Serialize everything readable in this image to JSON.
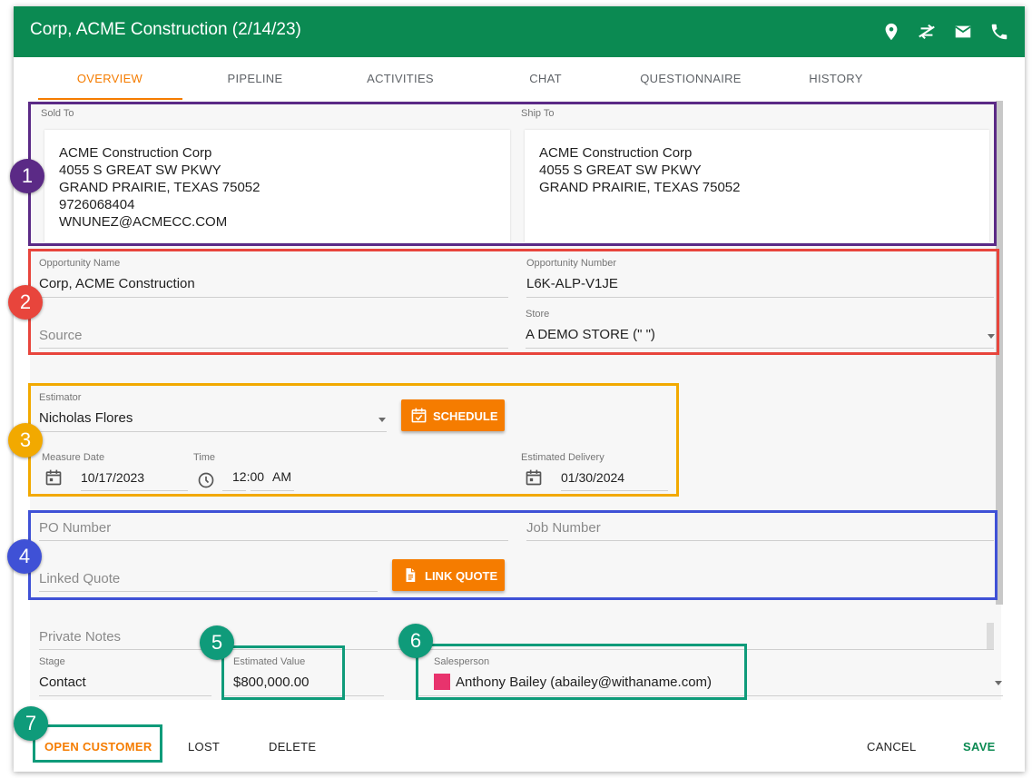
{
  "header": {
    "title": "Corp, ACME Construction (2/14/23)"
  },
  "tabs": [
    {
      "label": "OVERVIEW"
    },
    {
      "label": "PIPELINE"
    },
    {
      "label": "ACTIVITIES"
    },
    {
      "label": "CHAT"
    },
    {
      "label": "QUESTIONNAIRE"
    },
    {
      "label": "HISTORY"
    }
  ],
  "sold_to": {
    "label": "Sold To",
    "lines": [
      "ACME Construction Corp",
      "4055 S GREAT SW PKWY",
      "GRAND PRAIRIE, TEXAS 75052",
      "9726068404",
      "WNUNEZ@ACMECC.COM"
    ]
  },
  "ship_to": {
    "label": "Ship To",
    "lines": [
      "ACME Construction Corp",
      "4055 S GREAT SW PKWY",
      "GRAND PRAIRIE, TEXAS 75052"
    ]
  },
  "opportunity": {
    "name_label": "Opportunity Name",
    "name_value": "Corp, ACME Construction",
    "number_label": "Opportunity Number",
    "number_value": "L6K-ALP-V1JE",
    "source_placeholder": "Source",
    "store_label": "Store",
    "store_value": "A DEMO STORE (\" \")"
  },
  "estimator": {
    "label": "Estimator",
    "value": "Nicholas Flores",
    "schedule_button": "SCHEDULE",
    "measure_date_label": "Measure Date",
    "measure_date_value": "10/17/2023",
    "time_label": "Time",
    "time_hour": "12:00",
    "time_ampm": "AM",
    "delivery_label": "Estimated Delivery",
    "delivery_value": "01/30/2024"
  },
  "po": {
    "po_placeholder": "PO Number",
    "job_placeholder": "Job Number",
    "linked_quote_placeholder": "Linked Quote",
    "link_quote_button": "LINK QUOTE"
  },
  "notes": {
    "private_notes_placeholder": "Private Notes"
  },
  "stage": {
    "label": "Stage",
    "value": "Contact"
  },
  "estimated_value": {
    "label": "Estimated Value",
    "value": "$800,000.00"
  },
  "salesperson": {
    "label": "Salesperson",
    "value": "Anthony Bailey (abailey@withaname.com)",
    "color": "#e8336d"
  },
  "footer": {
    "open_customer": "OPEN CUSTOMER",
    "lost": "LOST",
    "delete": "DELETE",
    "cancel": "CANCEL",
    "save": "SAVE"
  },
  "annotations": [
    {
      "number": "1",
      "color": "#5b2a86"
    },
    {
      "number": "2",
      "color": "#e8453c"
    },
    {
      "number": "3",
      "color": "#f2a900"
    },
    {
      "number": "4",
      "color": "#3f51d6"
    },
    {
      "number": "5",
      "color": "#0f9b7a"
    },
    {
      "number": "6",
      "color": "#0f9b7a"
    },
    {
      "number": "7",
      "color": "#0f9b7a"
    }
  ],
  "icons": [
    "location-pin-icon",
    "directions-icon",
    "email-icon",
    "phone-icon",
    "calendar-icon",
    "clock-icon",
    "document-icon",
    "calendar-check-icon",
    "dropdown-caret-icon"
  ],
  "colors": {
    "header": "#0b8a52",
    "accent": "#f57c00",
    "save": "#0b8a52"
  }
}
